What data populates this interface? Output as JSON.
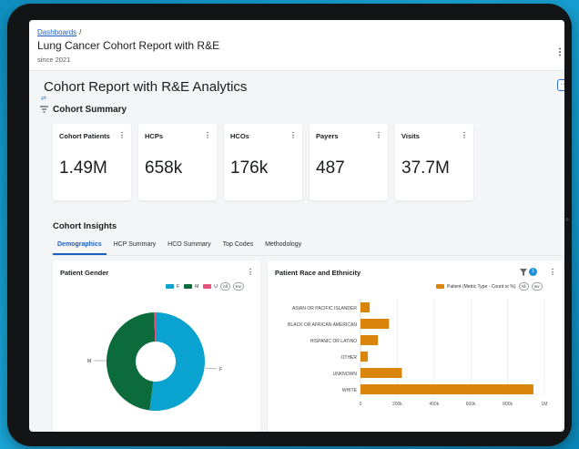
{
  "header": {
    "breadcrumb": "Dashboards",
    "breadcrumb_sep": "/",
    "report_title": "Lung Cancer Cohort Report with R&E",
    "report_subtitle": "since 2021"
  },
  "page": {
    "title": "Cohort Report with R&E Analytics",
    "more_label": "···"
  },
  "summary": {
    "title": "Cohort Summary",
    "cards": [
      {
        "label": "Cohort Patients",
        "value": "1.49M"
      },
      {
        "label": "HCPs",
        "value": "658k"
      },
      {
        "label": "HCOs",
        "value": "176k"
      },
      {
        "label": "Payers",
        "value": "487"
      },
      {
        "label": "Visits",
        "value": "37.7M"
      }
    ]
  },
  "insights": {
    "title": "Cohort Insights",
    "tabs": [
      "Demographics",
      "HCP Summary",
      "HCO Summary",
      "Top Codes",
      "Methodology"
    ],
    "active_tab": "Demographics"
  },
  "gender_panel": {
    "title": "Patient Gender",
    "legend": [
      {
        "label": "F",
        "color": "#0aa3cf"
      },
      {
        "label": "M",
        "color": "#0b6b3a"
      },
      {
        "label": "U",
        "color": "#e8517d"
      }
    ],
    "pill_all": "All",
    "pill_inv": "Inv"
  },
  "race_panel": {
    "title": "Patient Race and Ethnicity",
    "legend_label": "Patient (Metric Type - Count or %)",
    "legend_color": "#d9850b",
    "pill_all": "All",
    "pill_inv": "Inv",
    "filter_count": "1"
  },
  "chart_data": [
    {
      "type": "pie",
      "title": "Patient Gender",
      "donut": true,
      "categories": [
        "F",
        "M",
        "U"
      ],
      "values": [
        52,
        47.5,
        0.5
      ],
      "colors": [
        "#0aa3cf",
        "#0b6b3a",
        "#e8517d"
      ],
      "slice_labels": [
        "F",
        "M"
      ]
    },
    {
      "type": "bar",
      "orientation": "horizontal",
      "title": "Patient Race and Ethnicity",
      "categories": [
        "ASIAN OR PACIFIC ISLANDER",
        "BLACK OR AFRICAN AMERICAN",
        "HISPANIC OR LATINO",
        "OTHER",
        "UNKNOWN",
        "WHITE"
      ],
      "series": [
        {
          "name": "Patient (Metric Type - Count or %)",
          "values": [
            50000,
            155000,
            95000,
            40000,
            225000,
            940000
          ],
          "color": "#d9850b"
        }
      ],
      "xlim": [
        0,
        1000000
      ],
      "xticks": [
        "0",
        "200k",
        "400k",
        "600k",
        "800k",
        "1M"
      ],
      "grid": true,
      "legend": "top-right"
    }
  ]
}
